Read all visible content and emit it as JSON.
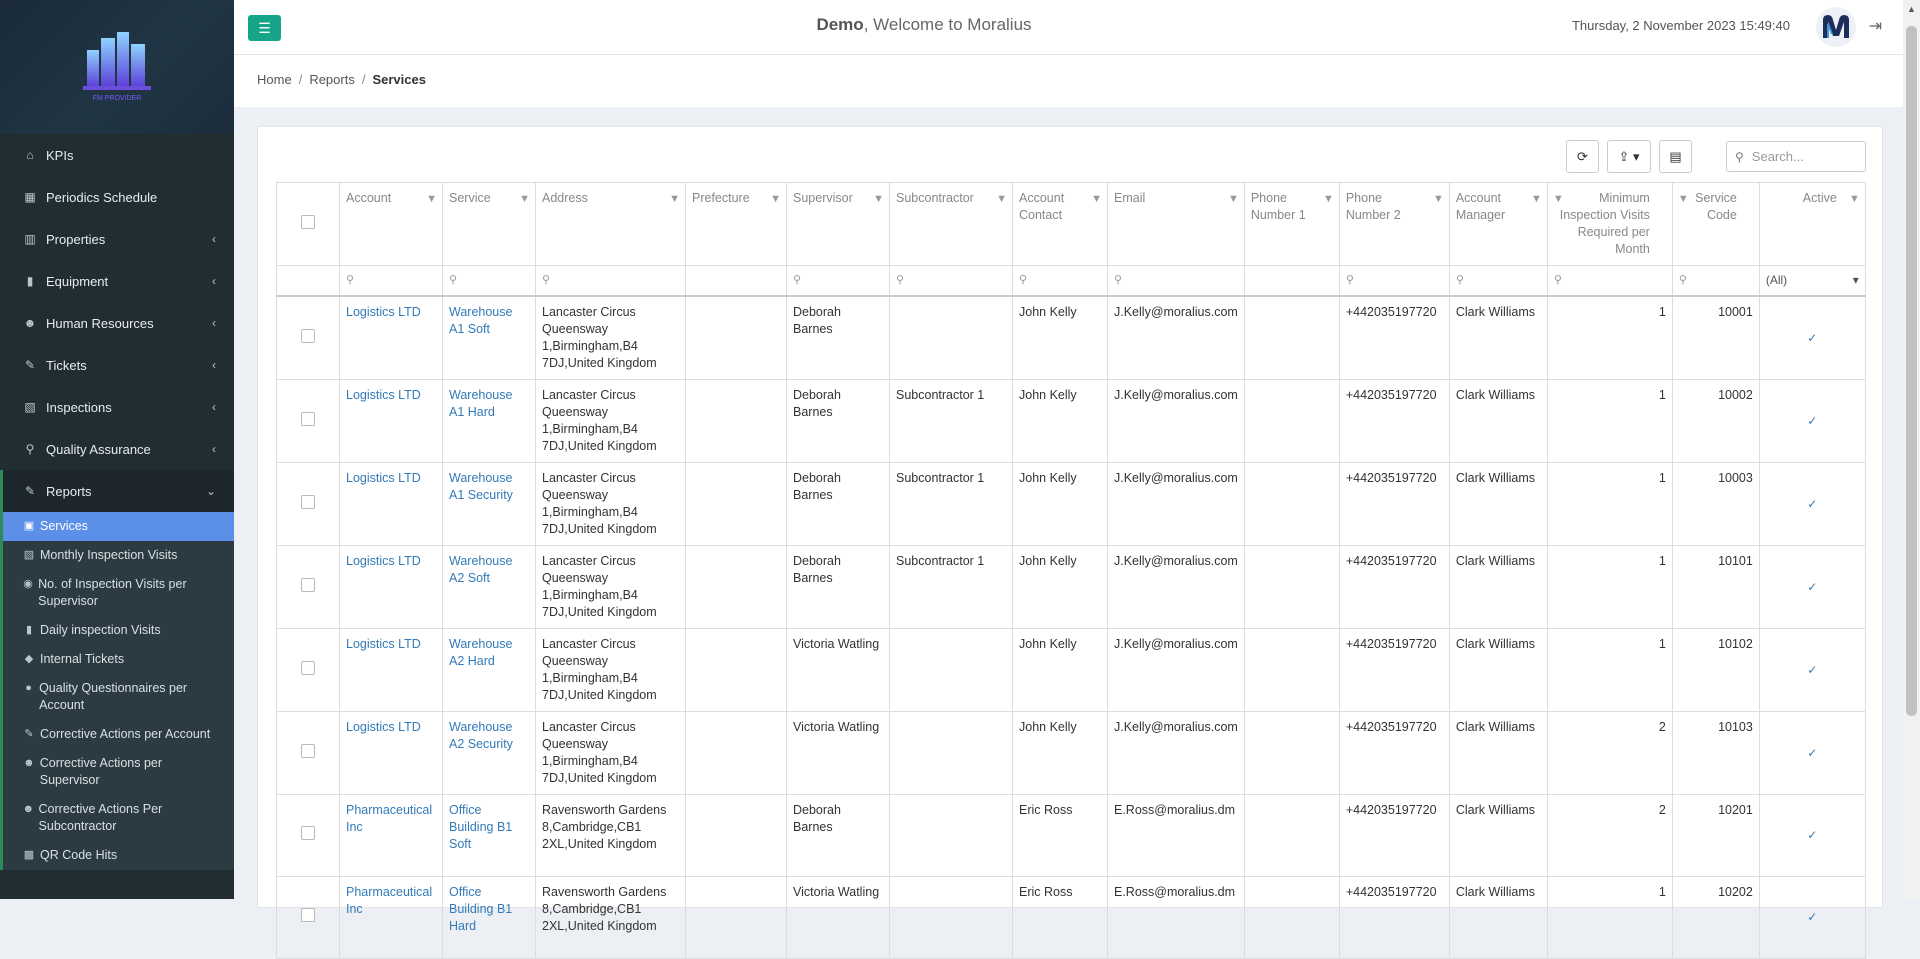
{
  "app": {
    "user": "Demo",
    "welcome_suffix": ", Welcome to Moralius",
    "datetime": "Thursday, 2 November 2023 15:49:40",
    "logo_caption": "FM PROVIDER"
  },
  "breadcrumb": [
    "Home",
    "Reports",
    "Services"
  ],
  "sidebar": {
    "items": [
      {
        "label": "KPIs",
        "icon": "home-icon",
        "glyph": "⌂",
        "expandable": false
      },
      {
        "label": "Periodics Schedule",
        "icon": "calendar-icon",
        "glyph": "▦",
        "expandable": false
      },
      {
        "label": "Properties",
        "icon": "building-icon",
        "glyph": "▥",
        "expandable": true
      },
      {
        "label": "Equipment",
        "icon": "book-icon",
        "glyph": "▮",
        "expandable": true
      },
      {
        "label": "Human Resources",
        "icon": "users-icon",
        "glyph": "☻",
        "expandable": true
      },
      {
        "label": "Tickets",
        "icon": "wrench-icon",
        "glyph": "✎",
        "expandable": true
      },
      {
        "label": "Inspections",
        "icon": "map-icon",
        "glyph": "▧",
        "expandable": true
      },
      {
        "label": "Quality Assurance",
        "icon": "search-icon",
        "glyph": "⚲",
        "expandable": true
      },
      {
        "label": "Reports",
        "icon": "report-icon",
        "glyph": "✎",
        "expandable": true,
        "open": true
      }
    ],
    "reports_submenu": [
      {
        "label": "Services",
        "icon": "calendar-check-icon",
        "glyph": "▣",
        "active": true
      },
      {
        "label": "Monthly Inspection Visits",
        "icon": "map-icon",
        "glyph": "▧"
      },
      {
        "label": "No. of Inspection Visits per Supervisor",
        "icon": "user-circle-icon",
        "glyph": "◉"
      },
      {
        "label": "Daily inspection Visits",
        "icon": "book-icon",
        "glyph": "▮"
      },
      {
        "label": "Internal Tickets",
        "icon": "ticket-icon",
        "glyph": "◆"
      },
      {
        "label": "Quality Questionnaires per Account",
        "icon": "check-circle-icon",
        "glyph": "●"
      },
      {
        "label": "Corrective Actions per Account",
        "icon": "wrench-icon",
        "glyph": "✎"
      },
      {
        "label": "Corrective Actions per Supervisor",
        "icon": "users-icon",
        "glyph": "☻"
      },
      {
        "label": "Corrective Actions Per Subcontractor",
        "icon": "users-icon",
        "glyph": "☻"
      },
      {
        "label": "QR Code Hits",
        "icon": "qrcode-icon",
        "glyph": "▩"
      }
    ]
  },
  "toolbar": {
    "search_placeholder": "Search..."
  },
  "table": {
    "columns": [
      {
        "key": "account",
        "label": "Account"
      },
      {
        "key": "service",
        "label": "Service"
      },
      {
        "key": "address",
        "label": "Address"
      },
      {
        "key": "prefecture",
        "label": "Prefecture"
      },
      {
        "key": "supervisor",
        "label": "Supervisor"
      },
      {
        "key": "subcontractor",
        "label": "Subcontractor"
      },
      {
        "key": "contact",
        "label": "Account Contact"
      },
      {
        "key": "email",
        "label": "Email"
      },
      {
        "key": "phone1",
        "label": "Phone Number 1"
      },
      {
        "key": "phone2",
        "label": "Phone Number 2"
      },
      {
        "key": "manager",
        "label": "Account Manager"
      },
      {
        "key": "visits",
        "label": "Minimum Inspection Visits Required per Month"
      },
      {
        "key": "code",
        "label": "Service Code"
      },
      {
        "key": "active",
        "label": "Active"
      }
    ],
    "active_filter": "(All)",
    "rows": [
      {
        "account": "Logistics LTD",
        "service": "Warehouse A1 Soft",
        "address": "Lancaster Circus Queensway 1,Birmingham,B4 7DJ,United Kingdom",
        "prefecture": "",
        "supervisor": "Deborah Barnes",
        "subcontractor": "",
        "contact": "John Kelly",
        "email": "J.Kelly@moralius.com",
        "phone1": "",
        "phone2": "+442035197720",
        "manager": "Clark Williams",
        "visits": "1",
        "code": "10001",
        "active": "✓"
      },
      {
        "account": "Logistics LTD",
        "service": "Warehouse A1 Hard",
        "address": "Lancaster Circus Queensway 1,Birmingham,B4 7DJ,United Kingdom",
        "prefecture": "",
        "supervisor": "Deborah Barnes",
        "subcontractor": "Subcontractor 1",
        "contact": "John Kelly",
        "email": "J.Kelly@moralius.com",
        "phone1": "",
        "phone2": "+442035197720",
        "manager": "Clark Williams",
        "visits": "1",
        "code": "10002",
        "active": "✓"
      },
      {
        "account": "Logistics LTD",
        "service": "Warehouse A1 Security",
        "address": "Lancaster Circus Queensway 1,Birmingham,B4 7DJ,United Kingdom",
        "prefecture": "",
        "supervisor": "Deborah Barnes",
        "subcontractor": "Subcontractor 1",
        "contact": "John Kelly",
        "email": "J.Kelly@moralius.com",
        "phone1": "",
        "phone2": "+442035197720",
        "manager": "Clark Williams",
        "visits": "1",
        "code": "10003",
        "active": "✓"
      },
      {
        "account": "Logistics LTD",
        "service": "Warehouse A2 Soft",
        "address": "Lancaster Circus Queensway 1,Birmingham,B4 7DJ,United Kingdom",
        "prefecture": "",
        "supervisor": "Deborah Barnes",
        "subcontractor": "Subcontractor 1",
        "contact": "John Kelly",
        "email": "J.Kelly@moralius.com",
        "phone1": "",
        "phone2": "+442035197720",
        "manager": "Clark Williams",
        "visits": "1",
        "code": "10101",
        "active": "✓"
      },
      {
        "account": "Logistics LTD",
        "service": "Warehouse A2 Hard",
        "address": "Lancaster Circus Queensway 1,Birmingham,B4 7DJ,United Kingdom",
        "prefecture": "",
        "supervisor": "Victoria Watling",
        "subcontractor": "",
        "contact": "John Kelly",
        "email": "J.Kelly@moralius.com",
        "phone1": "",
        "phone2": "+442035197720",
        "manager": "Clark Williams",
        "visits": "1",
        "code": "10102",
        "active": "✓"
      },
      {
        "account": "Logistics LTD",
        "service": "Warehouse A2 Security",
        "address": "Lancaster Circus Queensway 1,Birmingham,B4 7DJ,United Kingdom",
        "prefecture": "",
        "supervisor": "Victoria Watling",
        "subcontractor": "",
        "contact": "John Kelly",
        "email": "J.Kelly@moralius.com",
        "phone1": "",
        "phone2": "+442035197720",
        "manager": "Clark Williams",
        "visits": "2",
        "code": "10103",
        "active": "✓"
      },
      {
        "account": "Pharmaceutical Inc",
        "service": "Office Building B1 Soft",
        "address": "Ravensworth Gardens 8,Cambridge,CB1 2XL,United Kingdom",
        "prefecture": "",
        "supervisor": "Deborah Barnes",
        "subcontractor": "",
        "contact": "Eric Ross",
        "email": "E.Ross@moralius.dm",
        "phone1": "",
        "phone2": "+442035197720",
        "manager": "Clark Williams",
        "visits": "2",
        "code": "10201",
        "active": "✓"
      },
      {
        "account": "Pharmaceutical Inc",
        "service": "Office Building B1 Hard",
        "address": "Ravensworth Gardens 8,Cambridge,CB1 2XL,United Kingdom",
        "prefecture": "",
        "supervisor": "Victoria Watling",
        "subcontractor": "",
        "contact": "Eric Ross",
        "email": "E.Ross@moralius.dm",
        "phone1": "",
        "phone2": "+442035197720",
        "manager": "Clark Williams",
        "visits": "1",
        "code": "10202",
        "active": "✓"
      }
    ]
  }
}
